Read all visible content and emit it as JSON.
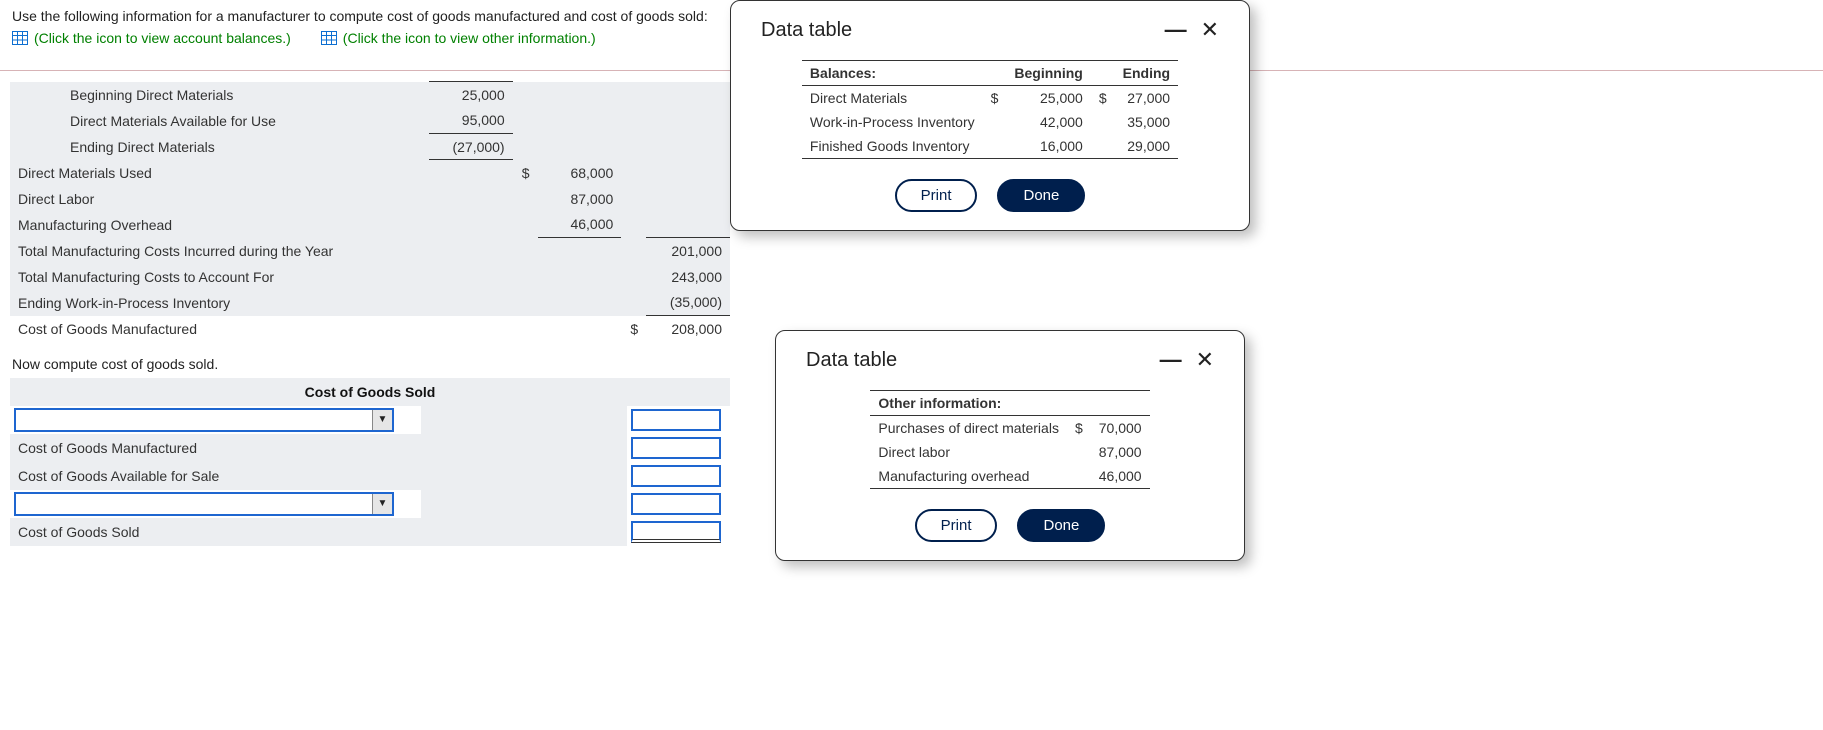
{
  "question": {
    "prompt": "Use the following information for a manufacturer to compute cost of goods manufactured and cost of goods sold:",
    "link1": "(Click the icon to view account balances.)",
    "link2": "(Click the icon to view other information.)"
  },
  "schedule": {
    "rows": [
      {
        "label": "Beginning Direct Materials",
        "c1": "25,000",
        "c1_bt": true,
        "indent": true
      },
      {
        "label": "Direct Materials Available for Use",
        "c1": "95,000",
        "indent": true
      },
      {
        "label": "Ending Direct Materials",
        "c1": "(27,000)",
        "c1_bt": true,
        "c1_bb": true,
        "indent": true
      },
      {
        "label": "Direct Materials Used",
        "c2cur": "$",
        "c2": "68,000"
      },
      {
        "label": "Direct Labor",
        "c2": "87,000"
      },
      {
        "label": "Manufacturing Overhead",
        "c2": "46,000",
        "c2_bb": true
      },
      {
        "label": "Total Manufacturing Costs Incurred during the Year",
        "c3": "201,000",
        "c3_bt": true
      },
      {
        "label": "Total Manufacturing Costs to Account For",
        "c3": "243,000"
      },
      {
        "label": "Ending Work-in-Process Inventory",
        "c3": "(35,000)",
        "c3_bb": true
      },
      {
        "label": "Cost of Goods Manufactured",
        "c3cur": "$",
        "c3": "208,000",
        "c3_bt": true,
        "noshade": true
      }
    ]
  },
  "sub_instruction": "Now compute cost of goods sold.",
  "cogs": {
    "header": "Cost of Goods Sold",
    "rows": [
      {
        "label_input": true
      },
      {
        "label": "Cost of Goods Manufactured"
      },
      {
        "label": "Cost of Goods Available for Sale"
      },
      {
        "label_input": true
      },
      {
        "label": "Cost of Goods Sold",
        "dbl": true
      }
    ]
  },
  "modal1": {
    "title": "Data table",
    "tbl": {
      "head": [
        "Balances:",
        "Beginning",
        "Ending"
      ],
      "rows": [
        {
          "label": "Direct Materials",
          "curB": "$",
          "beg": "25,000",
          "curE": "$",
          "end": "27,000"
        },
        {
          "label": "Work-in-Process Inventory",
          "beg": "42,000",
          "end": "35,000"
        },
        {
          "label": "Finished Goods Inventory",
          "beg": "16,000",
          "end": "29,000"
        }
      ]
    },
    "print": "Print",
    "done": "Done"
  },
  "modal2": {
    "title": "Data table",
    "tbl": {
      "head": "Other information:",
      "rows": [
        {
          "label": "Purchases of direct materials",
          "cur": "$",
          "val": "70,000"
        },
        {
          "label": "Direct labor",
          "val": "87,000"
        },
        {
          "label": "Manufacturing overhead",
          "val": "46,000"
        }
      ]
    },
    "print": "Print",
    "done": "Done"
  }
}
